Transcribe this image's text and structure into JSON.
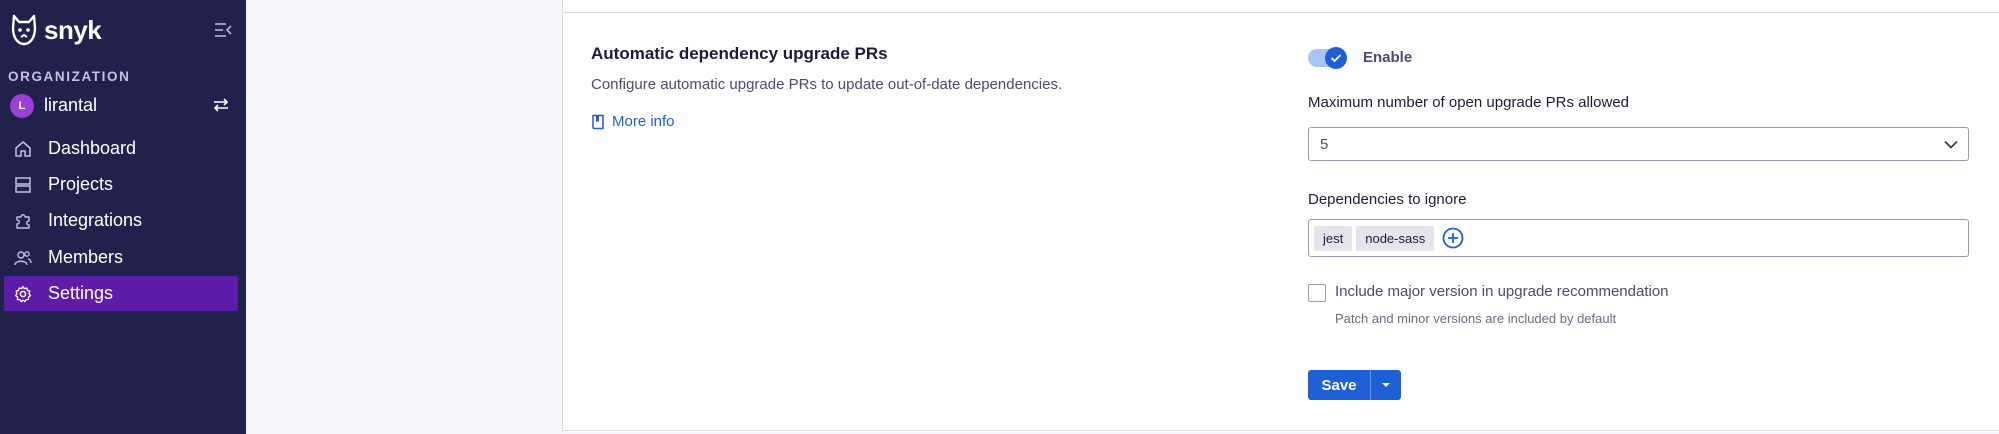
{
  "sidebar": {
    "logo_text": "snyk",
    "org_label": "ORGANIZATION",
    "org_avatar": "L",
    "org_name": "lirantal",
    "nav": [
      {
        "label": "Dashboard",
        "icon": "home-icon"
      },
      {
        "label": "Projects",
        "icon": "projects-icon"
      },
      {
        "label": "Integrations",
        "icon": "puzzle-icon"
      },
      {
        "label": "Members",
        "icon": "members-icon"
      },
      {
        "label": "Settings",
        "icon": "gear-icon",
        "active": true
      }
    ],
    "colors": {
      "background": "#22214c",
      "active": "#5d1ca8"
    }
  },
  "main": {
    "section_title": "Automatic dependency upgrade PRs",
    "section_description": "Configure automatic upgrade PRs to update out-of-date dependencies.",
    "more_info_label": "More info",
    "enable_toggle": {
      "label": "Enable",
      "on": true
    },
    "max_prs": {
      "label": "Maximum number of open upgrade PRs allowed",
      "value": "5"
    },
    "ignore_deps": {
      "label": "Dependencies to ignore",
      "tags": [
        "jest",
        "node-sass"
      ]
    },
    "major_version": {
      "label": "Include major version in upgrade recommendation",
      "hint": "Patch and minor versions are included by default",
      "checked": false
    },
    "save_label": "Save",
    "colors": {
      "accent": "#1d5fd6"
    }
  }
}
